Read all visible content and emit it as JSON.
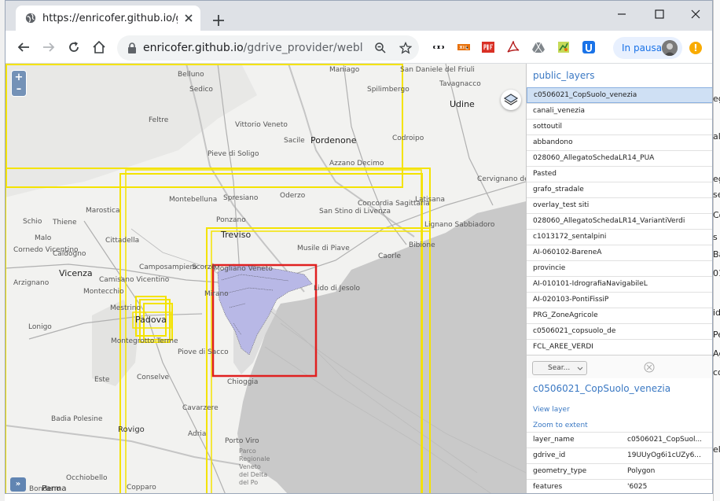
{
  "browser": {
    "tab_title": "https://enricofer.github.io/gdrive",
    "url_host": "enricofer.github.io",
    "url_path": "/gdrive_provider/weblink...",
    "profile_label": "In pausa",
    "alert_glyph": "!"
  },
  "map": {
    "labels": [
      {
        "text": "Maniago",
        "cls": ""
      },
      {
        "text": "San Daniele del Friuli",
        "cls": ""
      },
      {
        "text": "Tavagnacco",
        "cls": ""
      },
      {
        "text": "Spilimbergo",
        "cls": ""
      },
      {
        "text": "Udine",
        "cls": "big"
      },
      {
        "text": "Belluno",
        "cls": ""
      },
      {
        "text": "Sedico",
        "cls": ""
      },
      {
        "text": "Feltre",
        "cls": ""
      },
      {
        "text": "Vittorio Veneto",
        "cls": ""
      },
      {
        "text": "Sacile",
        "cls": ""
      },
      {
        "text": "Pordenone",
        "cls": "big"
      },
      {
        "text": "Codroipo",
        "cls": ""
      },
      {
        "text": "Pieve di Soligo",
        "cls": ""
      },
      {
        "text": "Azzano Decimo",
        "cls": ""
      },
      {
        "text": "Cervignano del Friuli",
        "cls": ""
      },
      {
        "text": "Montebelluna",
        "cls": ""
      },
      {
        "text": "Spresiano",
        "cls": ""
      },
      {
        "text": "Oderzo",
        "cls": ""
      },
      {
        "text": "Concordia Sagittaria",
        "cls": ""
      },
      {
        "text": "Latisana",
        "cls": ""
      },
      {
        "text": "Schio",
        "cls": ""
      },
      {
        "text": "Thiene",
        "cls": ""
      },
      {
        "text": "Marostica",
        "cls": ""
      },
      {
        "text": "Ponzano",
        "cls": ""
      },
      {
        "text": "San Stino di Livenza",
        "cls": ""
      },
      {
        "text": "Lignano Sabbiadoro",
        "cls": ""
      },
      {
        "text": "Malo",
        "cls": ""
      },
      {
        "text": "Cittadella",
        "cls": ""
      },
      {
        "text": "Treviso",
        "cls": "big"
      },
      {
        "text": "Bibione",
        "cls": ""
      },
      {
        "text": "Cornedo Vicentino",
        "cls": ""
      },
      {
        "text": "Caldogno",
        "cls": ""
      },
      {
        "text": "Musile di Piave",
        "cls": ""
      },
      {
        "text": "Caorle",
        "cls": ""
      },
      {
        "text": "Camposampiero",
        "cls": ""
      },
      {
        "text": "Scorzè",
        "cls": ""
      },
      {
        "text": "Mogliano Veneto",
        "cls": ""
      },
      {
        "text": "Vicenza",
        "cls": "big"
      },
      {
        "text": "Arzignano",
        "cls": ""
      },
      {
        "text": "Camisano Vicentino",
        "cls": ""
      },
      {
        "text": "Mirano",
        "cls": ""
      },
      {
        "text": "Lido di Jesolo",
        "cls": ""
      },
      {
        "text": "Montecchio",
        "cls": ""
      },
      {
        "text": "Mestrino",
        "cls": ""
      },
      {
        "text": "Padova",
        "cls": "big"
      },
      {
        "text": "Lonigo",
        "cls": ""
      },
      {
        "text": "Montegrotto Terme",
        "cls": ""
      },
      {
        "text": "Piove di Sacco",
        "cls": ""
      },
      {
        "text": "Este",
        "cls": ""
      },
      {
        "text": "Conselve",
        "cls": ""
      },
      {
        "text": "Chioggia",
        "cls": ""
      },
      {
        "text": "Cavarzere",
        "cls": ""
      },
      {
        "text": "Badia Polesine",
        "cls": ""
      },
      {
        "text": "Rovigo",
        "cls": "city"
      },
      {
        "text": "Adria",
        "cls": ""
      },
      {
        "text": "Porto Viro",
        "cls": ""
      },
      {
        "text": "Parco Regionale Veneto del Delta del Po",
        "cls": "sea"
      },
      {
        "text": "Occhiobello",
        "cls": ""
      },
      {
        "text": "Copparo",
        "cls": ""
      },
      {
        "text": "Bondeno",
        "cls": ""
      },
      {
        "text": "Parma",
        "cls": "city"
      }
    ]
  },
  "panel": {
    "title": "public_layers",
    "layers": [
      "c0506021_CopSuolo_venezia",
      "canali_venezia",
      "sottoutil",
      "abbandono",
      "028060_AllegatoSchedaLR14_PUA",
      "Pasted",
      "grafo_stradale",
      "overlay_test siti",
      "028060_AllegatoSchedaLR14_VariantiVerdi",
      "c1013172_sentalpini",
      "AI-060102-BareneA",
      "provincie",
      "AI-010101-IdrografiaNavigabileL",
      "AI-020103-PontiFissiP",
      "PRG_ZoneAgricole",
      "c0506021_copsuolo_de",
      "FCL_AREE_VERDI"
    ],
    "search_label": "Sear...",
    "detail_title": "c0506021_CopSuolo_venezia",
    "view_layer": "View layer",
    "zoom_extent": "Zoom to extent",
    "attributes": [
      {
        "key": "layer_name",
        "value": "c0506021_CopSuol..."
      },
      {
        "key": "gdrive_id",
        "value": "19UUyOg6i1cUZy6..."
      },
      {
        "key": "geometry_type",
        "value": "Polygon"
      },
      {
        "key": "features",
        "value": "'6025"
      }
    ]
  },
  "background_window_chars": [
    "eg",
    "al",
    "eg",
    "se",
    "Co",
    "s",
    "Ba",
    "01",
    "idi",
    "Pe",
    "Ag",
    "co",
    "ele"
  ]
}
